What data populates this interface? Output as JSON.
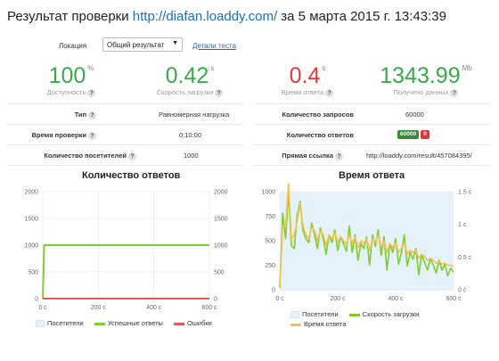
{
  "header": {
    "prefix": "Результат проверки",
    "url": "http://diafan.loaddy.com/",
    "suffix": "за 5 марта 2015 г. 13:43:39"
  },
  "location": {
    "label": "Локация",
    "selected": "Общий результат",
    "details_link": "Детали теста"
  },
  "metrics": [
    {
      "value": "100",
      "unit": "%",
      "caption": "Доступность",
      "color": "#3aa94a"
    },
    {
      "value": "0.42",
      "unit": "s",
      "caption": "Скорость загрузки",
      "color": "#3aa94a"
    },
    {
      "value": "0.4",
      "unit": "s",
      "caption": "Время ответа",
      "color": "#e03a3a"
    },
    {
      "value": "1343.99",
      "unit": "Mb",
      "caption": "Получено данных",
      "color": "#3aa94a"
    }
  ],
  "left_table": [
    {
      "key": "Тип",
      "value": "Равномерная нагрузка"
    },
    {
      "key": "Время проверки",
      "value": "0:10:00"
    },
    {
      "key": "Количество посетителей",
      "value": "1000"
    }
  ],
  "right_table": {
    "requests_label": "Количество запросов",
    "requests_value": "60000",
    "responses_label": "Количество ответов",
    "responses_ok": "60000",
    "responses_err": "0",
    "link_label": "Прямая ссылка",
    "link_value": "http://loaddy.com/result/457084395/"
  },
  "chart_data": [
    {
      "type": "line",
      "title": "Количество ответов",
      "x_ticks": [
        "0 с",
        "200 с",
        "400 с",
        "600 с"
      ],
      "xlim": [
        0,
        600
      ],
      "y_left_ticks": [
        "0",
        "500",
        "1000",
        "1500",
        "2000"
      ],
      "y_right_ticks": [
        "0",
        "500",
        "1000",
        "1500",
        "2000"
      ],
      "ylim": [
        0,
        2000
      ],
      "series": [
        {
          "name": "Посетители",
          "color": "#e6f2fa",
          "x": [
            0,
            600
          ],
          "y": [
            0,
            0
          ]
        },
        {
          "name": "Успешные ответы",
          "color": "#7fcc2e",
          "x": [
            0,
            5,
            10,
            600
          ],
          "y": [
            0,
            1000,
            1000,
            1000
          ]
        },
        {
          "name": "Ошибки",
          "color": "#e35a5a",
          "x": [
            0,
            600
          ],
          "y": [
            0,
            0
          ]
        }
      ]
    },
    {
      "type": "line",
      "title": "Время ответа",
      "x_ticks": [
        "0 с",
        "200 с",
        "400 с",
        "600 с"
      ],
      "xlim": [
        0,
        600
      ],
      "y_left_ticks": [
        "0",
        "250",
        "500",
        "750",
        "1000"
      ],
      "y_right_ticks": [
        "0 с",
        "0.5 с",
        "1 с",
        "1.5 с"
      ],
      "ylim": [
        0,
        1000
      ],
      "visitors": 1000,
      "series": [
        {
          "name": "Посетители",
          "color": "#e6f2fa"
        },
        {
          "name": "Скорость загрузки",
          "color": "#7fcc2e",
          "x": [
            0,
            10,
            20,
            30,
            40,
            50,
            60,
            70,
            80,
            90,
            100,
            110,
            120,
            130,
            140,
            150,
            160,
            170,
            180,
            190,
            200,
            210,
            220,
            230,
            240,
            250,
            260,
            270,
            280,
            290,
            300,
            310,
            320,
            330,
            340,
            350,
            360,
            370,
            380,
            390,
            400,
            410,
            420,
            430,
            440,
            450,
            460,
            470,
            480,
            490,
            500,
            510,
            520,
            530,
            540,
            550,
            560,
            570,
            580,
            590,
            600
          ],
          "y": [
            20,
            780,
            520,
            1000,
            450,
            420,
            760,
            900,
            600,
            520,
            480,
            680,
            560,
            420,
            630,
            520,
            360,
            560,
            480,
            610,
            400,
            540,
            470,
            390,
            650,
            380,
            560,
            300,
            470,
            420,
            540,
            250,
            560,
            440,
            610,
            350,
            540,
            200,
            470,
            380,
            520,
            260,
            380,
            560,
            240,
            380,
            310,
            420,
            150,
            360,
            280,
            200,
            320,
            250,
            170,
            300,
            200,
            260,
            140,
            220,
            180
          ]
        },
        {
          "name": "Время ответа",
          "color": "#f2c14e",
          "x": [
            0,
            10,
            20,
            30,
            40,
            50,
            60,
            70,
            80,
            90,
            100,
            110,
            120,
            130,
            140,
            150,
            160,
            170,
            180,
            190,
            200,
            210,
            220,
            230,
            240,
            250,
            260,
            270,
            280,
            290,
            300,
            310,
            320,
            330,
            340,
            350,
            360,
            370,
            380,
            390,
            400,
            410,
            420,
            430,
            440,
            450,
            460,
            470,
            480,
            490,
            500,
            510,
            520,
            530,
            540,
            550,
            560,
            570,
            580,
            590,
            600
          ],
          "y": [
            40,
            650,
            640,
            1080,
            520,
            560,
            700,
            880,
            650,
            560,
            520,
            640,
            600,
            500,
            600,
            560,
            450,
            560,
            520,
            580,
            480,
            540,
            500,
            460,
            560,
            470,
            540,
            430,
            500,
            470,
            520,
            400,
            520,
            480,
            560,
            430,
            500,
            380,
            470,
            430,
            480,
            380,
            420,
            480,
            360,
            400,
            380,
            400,
            320,
            360,
            340,
            300,
            320,
            300,
            270,
            290,
            260,
            270,
            250,
            250,
            240
          ]
        }
      ]
    }
  ]
}
